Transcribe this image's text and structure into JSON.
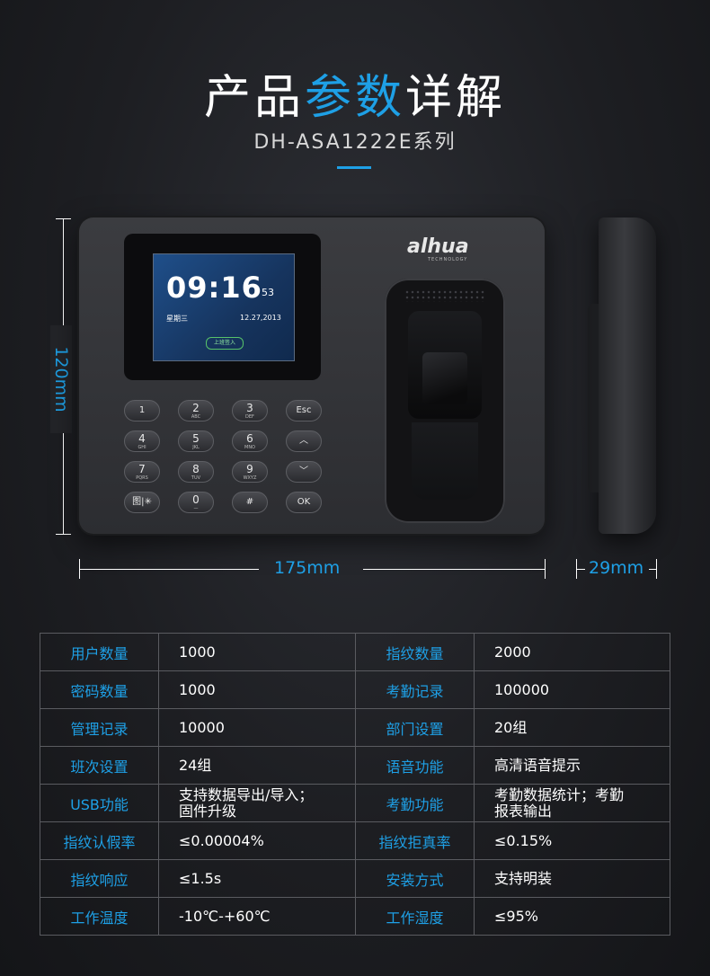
{
  "header": {
    "title_part1": "产品",
    "title_highlight": "参数",
    "title_part2": "详解",
    "subtitle": "DH-ASA1222E系列",
    "accent_color": "#1ea0e6"
  },
  "device": {
    "brand": "alhua",
    "brand_sub": "TECHNOLOGY",
    "screen": {
      "time": "09:16",
      "seconds": "53",
      "weekday": "星期三",
      "date": "12.27,2013",
      "button": "上班签入"
    },
    "keys": [
      {
        "num": "1",
        "letters": ""
      },
      {
        "num": "2",
        "letters": "ABC"
      },
      {
        "num": "3",
        "letters": "DEF"
      },
      {
        "num": "Esc",
        "letters": ""
      },
      {
        "num": "4",
        "letters": "GHI"
      },
      {
        "num": "5",
        "letters": "JKL"
      },
      {
        "num": "6",
        "letters": "MNO"
      },
      {
        "num": "︿",
        "letters": ""
      },
      {
        "num": "7",
        "letters": "PQRS"
      },
      {
        "num": "8",
        "letters": "TUV"
      },
      {
        "num": "9",
        "letters": "WXYZ"
      },
      {
        "num": "﹀",
        "letters": ""
      },
      {
        "num": "图|✳",
        "letters": ""
      },
      {
        "num": "0",
        "letters": "—"
      },
      {
        "num": "#",
        "letters": ""
      },
      {
        "num": "OK",
        "letters": ""
      }
    ]
  },
  "dimensions": {
    "height": "120mm",
    "width": "175mm",
    "depth": "29mm"
  },
  "specs": [
    {
      "k1": "用户数量",
      "v1": "1000",
      "k2": "指纹数量",
      "v2": "2000"
    },
    {
      "k1": "密码数量",
      "v1": "1000",
      "k2": "考勤记录",
      "v2": "100000"
    },
    {
      "k1": "管理记录",
      "v1": "10000",
      "k2": "部门设置",
      "v2": "20组"
    },
    {
      "k1": "班次设置",
      "v1": "24组",
      "k2": "语音功能",
      "v2": "高清语音提示"
    },
    {
      "k1": "USB功能",
      "v1": "支持数据导出/导入；\n固件升级",
      "k2": "考勤功能",
      "v2": "考勤数据统计；考勤\n报表输出"
    },
    {
      "k1": "指纹认假率",
      "v1": "≤0.00004%",
      "k2": "指纹拒真率",
      "v2": "≤0.15%"
    },
    {
      "k1": "指纹响应",
      "v1": "≤1.5s",
      "k2": "安装方式",
      "v2": "支持明装"
    },
    {
      "k1": "工作温度",
      "v1": "-10℃-+60℃",
      "k2": "工作湿度",
      "v2": "≤95%"
    }
  ]
}
